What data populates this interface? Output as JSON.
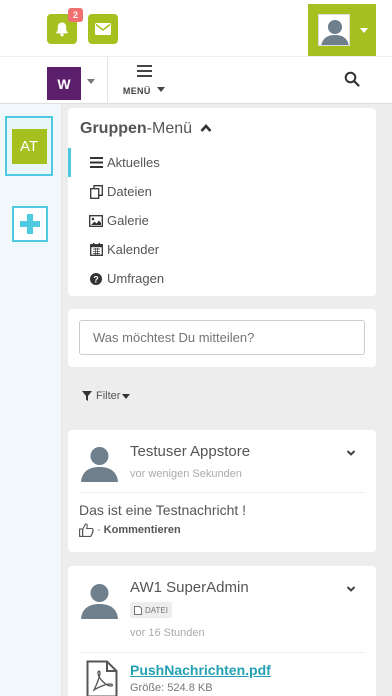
{
  "topbar": {
    "notifications_count": "2",
    "menu_label": "MENÜ",
    "space_letter": "W"
  },
  "sidebar": {
    "active_space_initials": "AT"
  },
  "group_menu": {
    "title_bold": "Gruppen",
    "title_light": "-Menü",
    "items": [
      {
        "label": "Aktuelles",
        "icon": "list-icon",
        "active": true
      },
      {
        "label": "Dateien",
        "icon": "files-icon",
        "active": false
      },
      {
        "label": "Galerie",
        "icon": "image-icon",
        "active": false
      },
      {
        "label": "Kalender",
        "icon": "calendar-icon",
        "active": false
      },
      {
        "label": "Umfragen",
        "icon": "question-icon",
        "active": false
      }
    ]
  },
  "composer": {
    "placeholder": "Was möchtest Du mitteilen?"
  },
  "filter_label": "Filter",
  "posts": [
    {
      "author": "Testuser Appstore",
      "time": "vor wenigen Sekunden",
      "message": "Das ist eine Testnachricht !",
      "comment_label": "Kommentieren"
    },
    {
      "author": "AW1 SuperAdmin",
      "tag": "DATEI",
      "time": "vor 16 Stunden",
      "file_name": "PushNachrichten.pdf",
      "file_size": "Größe: 524.8 KB"
    }
  ],
  "colors": {
    "accent_green": "#a6c11f",
    "accent_cyan": "#4fc9e0",
    "space_purple": "#5b1f6b",
    "badge_red": "#f2706f",
    "link_teal": "#21a1b3"
  }
}
